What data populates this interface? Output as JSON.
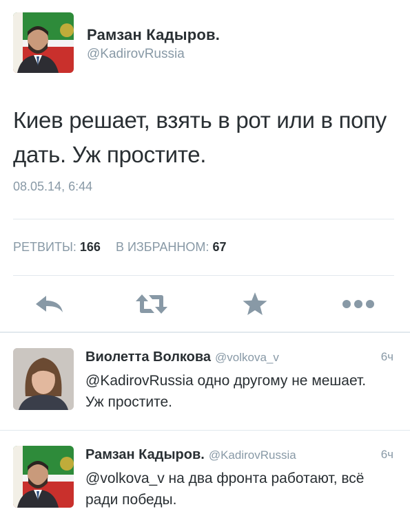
{
  "main_tweet": {
    "author_name": "Рамзан Кадыров.",
    "author_handle": "@KadirovRussia",
    "text": "Киев решает, взять в рот или в попу дать. Уж простите.",
    "timestamp": "08.05.14, 6:44",
    "stats": {
      "retweets_label": "РЕТВИТЫ:",
      "retweets_count": "166",
      "favorites_label": "В ИЗБРАННОМ:",
      "favorites_count": "67"
    },
    "actions": [
      "reply-icon",
      "retweet-icon",
      "favorite-star-icon",
      "more-dots-icon"
    ]
  },
  "replies": [
    {
      "author_name": "Виолетта Волкова",
      "author_handle": "@volkova_v",
      "time": "6ч",
      "text": "@KadirovRussia одно другому не мешает. Уж простите."
    },
    {
      "author_name": "Рамзан Кадыров.",
      "author_handle": "@KadirovRussia",
      "time": "6ч",
      "text": "@volkova_v на два фронта работают, всё ради победы."
    }
  ],
  "colors": {
    "text": "#292f33",
    "secondary": "#8899a6",
    "icon": "#8899a6",
    "divider": "#e1e8ed"
  }
}
